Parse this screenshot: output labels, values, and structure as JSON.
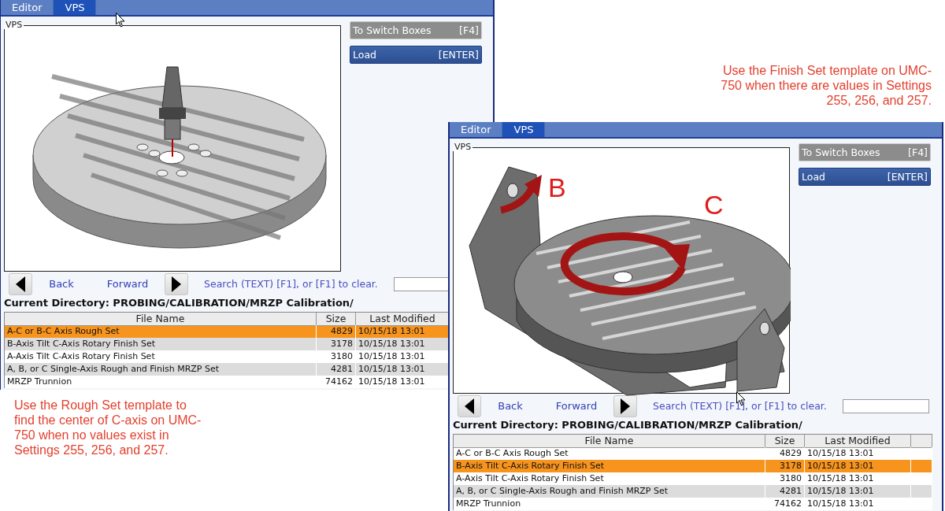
{
  "windows": [
    {
      "tabs": [
        {
          "label": "Editor",
          "selected": false
        },
        {
          "label": "VPS",
          "selected": true
        }
      ],
      "panel_title": "VPS",
      "image": {
        "kind": "rotary-table"
      },
      "buttons": [
        {
          "label": "To Switch Boxes",
          "key": "[F4]",
          "disabled": true
        },
        {
          "label": "Load",
          "key": "[ENTER]",
          "disabled": false
        }
      ],
      "nav": {
        "back": "Back",
        "forward": "Forward",
        "search_hint": "Search (TEXT) [F1], or [F1] to clear."
      },
      "current_directory": "Current Directory: PROBING/CALIBRATION/MRZP Calibration/",
      "table": {
        "columns": [
          "File Name",
          "Size",
          "Last Modified"
        ],
        "rows": [
          {
            "name": "A-C or B-C Axis Rough Set",
            "size": "4829",
            "modified": "10/15/18 13:01",
            "selected": true
          },
          {
            "name": "B-Axis Tilt C-Axis Rotary Finish Set",
            "size": "3178",
            "modified": "10/15/18 13:01",
            "selected": false
          },
          {
            "name": "A-Axis Tilt C-Axis Rotary Finish Set",
            "size": "3180",
            "modified": "10/15/18 13:01",
            "selected": false
          },
          {
            "name": "A, B, or C Single-Axis Rough and Finish MRZP Set",
            "size": "4281",
            "modified": "10/15/18 13:01",
            "selected": false
          },
          {
            "name": "MRZP Trunnion",
            "size": "74162",
            "modified": "10/15/18 13:01",
            "selected": false
          }
        ]
      }
    },
    {
      "tabs": [
        {
          "label": "Editor",
          "selected": false
        },
        {
          "label": "VPS",
          "selected": true
        }
      ],
      "panel_title": "VPS",
      "image": {
        "kind": "trunnion",
        "labels": [
          "B",
          "C"
        ]
      },
      "buttons": [
        {
          "label": "To Switch Boxes",
          "key": "[F4]",
          "disabled": true
        },
        {
          "label": "Load",
          "key": "[ENTER]",
          "disabled": false
        }
      ],
      "nav": {
        "back": "Back",
        "forward": "Forward",
        "search_hint": "Search (TEXT) [F1], or [F1] to clear."
      },
      "current_directory": "Current Directory: PROBING/CALIBRATION/MRZP Calibration/",
      "table": {
        "columns": [
          "File Name",
          "Size",
          "Last Modified"
        ],
        "rows": [
          {
            "name": "A-C or B-C Axis Rough Set",
            "size": "4829",
            "modified": "10/15/18 13:01",
            "selected": false
          },
          {
            "name": "B-Axis Tilt C-Axis Rotary Finish Set",
            "size": "3178",
            "modified": "10/15/18 13:01",
            "selected": true
          },
          {
            "name": "A-Axis Tilt C-Axis Rotary Finish Set",
            "size": "3180",
            "modified": "10/15/18 13:01",
            "selected": false
          },
          {
            "name": "A, B, or C Single-Axis Rough and Finish MRZP Set",
            "size": "4281",
            "modified": "10/15/18 13:01",
            "selected": false
          },
          {
            "name": "MRZP Trunnion",
            "size": "74162",
            "modified": "10/15/18 13:01",
            "selected": false
          }
        ]
      }
    }
  ],
  "notes": [
    "Use the Finish Set template on UMC-\n750 when there are values in Settings\n255, 256, and 257.",
    "Use the Rough Set template to\nfind the center of C-axis on UMC-\n750 when no values exist in\nSettings 255, 256, and 257."
  ]
}
